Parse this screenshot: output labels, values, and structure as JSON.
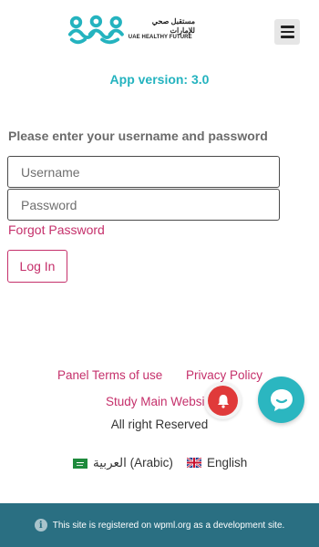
{
  "header": {
    "logo_ar": "مستقبل صحي للإمارات",
    "logo_en": "UAE HEALTHY FUTURE",
    "menu_icon": "hamburger-icon"
  },
  "app_version": "App version: 3.0",
  "login": {
    "prompt": "Please enter your username and password",
    "username_placeholder": "Username",
    "password_placeholder": "Password",
    "forgot_label": "Forgot Password",
    "login_label": "Log In"
  },
  "footer": {
    "terms_label": "Panel Terms of use",
    "privacy_label": "Privacy Policy",
    "study_label": "Study Main Website",
    "rights": "All right Reserved",
    "languages": [
      {
        "label": "العربية (Arabic)",
        "flag": "saudi-flag"
      },
      {
        "label": "English",
        "flag": "uk-flag"
      }
    ]
  },
  "dev_notice": "This site is registered on wpml.org as a development site.",
  "colors": {
    "accent_teal": "#24b3bf",
    "link_pink": "#c5306b",
    "dev_bar": "#2a6f82",
    "notification_red": "#e03a3a"
  }
}
